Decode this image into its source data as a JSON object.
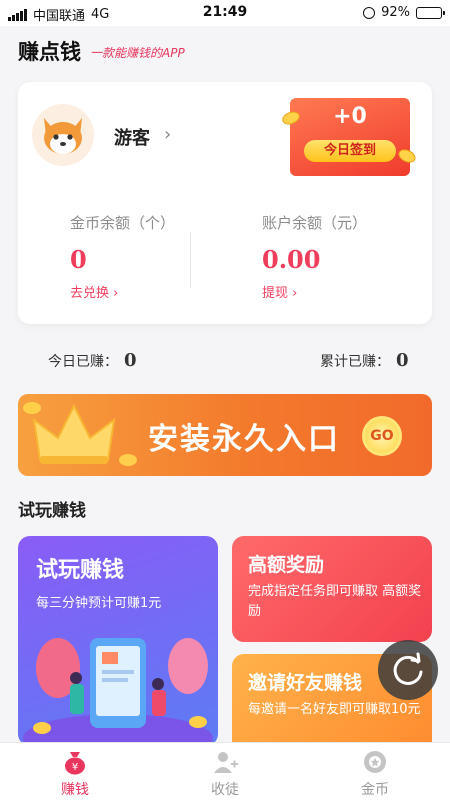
{
  "status_bar": {
    "carrier": "中国联通",
    "network": "4G",
    "time": "21:49",
    "battery": "92%",
    "battery_level": 0.92
  },
  "header": {
    "title": "赚点钱",
    "slogan": "一款能赚钱的APP"
  },
  "account": {
    "username": "游客",
    "signin_value": "+0",
    "signin_label": "今日签到",
    "coins_label": "金币余额（个）",
    "coins_value": "0",
    "coins_link": "去兑换 ›",
    "balance_label": "账户余额（元）",
    "balance_value": "0.00",
    "balance_link": "提现 ›"
  },
  "earnings": {
    "today_label": "今日已赚：",
    "today_value": "0",
    "total_label": "累计已赚：",
    "total_value": "0"
  },
  "install_banner": {
    "text": "安装永久入口",
    "go_label": "GO"
  },
  "section": {
    "title": "试玩赚钱"
  },
  "cards": {
    "trial": {
      "title": "试玩赚钱",
      "desc": "每三分钟预计可赚1元"
    },
    "reward": {
      "title": "高额奖励",
      "desc": "完成指定任务即可赚取 高额奖励"
    },
    "invite": {
      "title": "邀请好友赚钱",
      "desc": "每邀请一名好友即可赚取10元"
    }
  },
  "tabs": [
    {
      "label": "赚钱",
      "icon": "money-bag-icon",
      "active": true
    },
    {
      "label": "收徒",
      "icon": "add-user-icon",
      "active": false
    },
    {
      "label": "金币",
      "icon": "coin-icon",
      "active": false
    }
  ],
  "colors": {
    "accent": "#e8365e",
    "signin_bg": "#f03b2d",
    "banner_bg": "#f37a2c",
    "trial_bg": "#8a5cf6",
    "reward_bg": "#f3414f",
    "invite_bg": "#ff8a2e"
  }
}
